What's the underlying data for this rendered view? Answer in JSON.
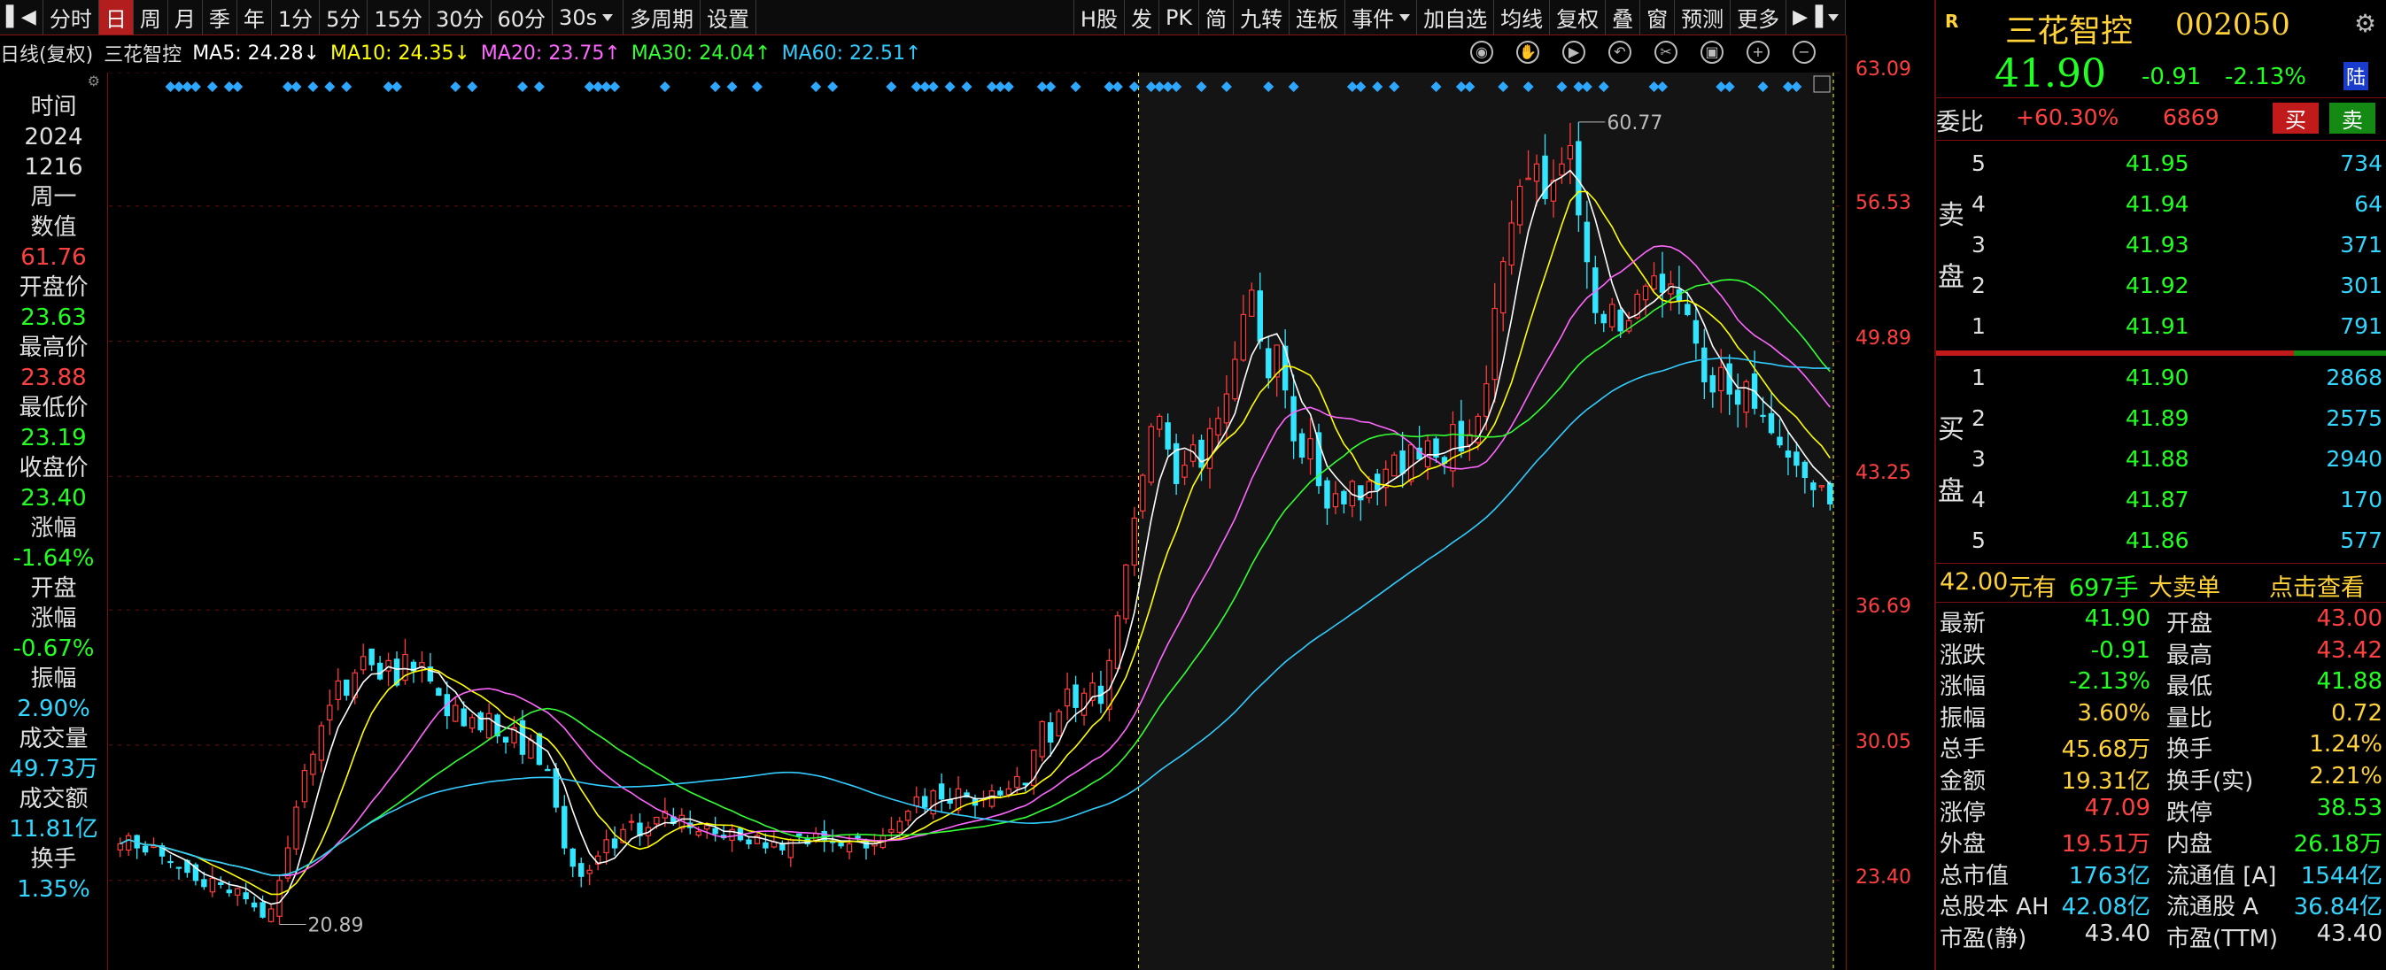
{
  "toolbar": {
    "left": [
      {
        "label": "分时",
        "active": false
      },
      {
        "label": "日",
        "active": true
      },
      {
        "label": "周",
        "active": false
      },
      {
        "label": "月",
        "active": false
      },
      {
        "label": "季",
        "active": false
      },
      {
        "label": "年",
        "active": false
      },
      {
        "label": "1分",
        "active": false
      },
      {
        "label": "5分",
        "active": false
      },
      {
        "label": "15分",
        "active": false
      },
      {
        "label": "30分",
        "active": false
      },
      {
        "label": "60分",
        "active": false
      }
    ],
    "period_select": "30s",
    "multi": "多周期",
    "settings": "设置",
    "right": [
      "H股",
      "发",
      "PK",
      "简",
      "九转",
      "连板",
      "事件"
    ],
    "right2": [
      "加自选",
      "均线",
      "复权",
      "叠",
      "窗",
      "预测",
      "更多"
    ]
  },
  "ma": {
    "mode": "日线(复权)",
    "stock": "三花智控",
    "ma5": "MA5: 24.28↓",
    "ma10": "MA10: 24.35↓",
    "ma20": "MA20: 23.75↑",
    "ma30": "MA30: 24.04↑",
    "ma60": "MA60: 22.51↑",
    "colors": {
      "ma5": "#ffffff",
      "ma10": "#ffff00",
      "ma20": "#ff66ff",
      "ma30": "#33ff33",
      "ma60": "#33ccff"
    }
  },
  "left_info": [
    {
      "label": "时间",
      "values": [
        {
          "v": "2024",
          "c": "white"
        },
        {
          "v": "1216",
          "c": "white"
        },
        {
          "v": "周一",
          "c": "white"
        }
      ]
    },
    {
      "label": "数值",
      "values": [
        {
          "v": "61.76",
          "c": "red"
        }
      ]
    },
    {
      "label": "开盘价",
      "values": [
        {
          "v": "23.63",
          "c": "green"
        }
      ]
    },
    {
      "label": "最高价",
      "values": [
        {
          "v": "23.88",
          "c": "red"
        }
      ]
    },
    {
      "label": "最低价",
      "values": [
        {
          "v": "23.19",
          "c": "green"
        }
      ]
    },
    {
      "label": "收盘价",
      "values": [
        {
          "v": "23.40",
          "c": "green"
        }
      ]
    },
    {
      "label": "涨幅",
      "values": [
        {
          "v": "-1.64%",
          "c": "green"
        }
      ]
    },
    {
      "label": "开盘",
      "values": []
    },
    {
      "label": "涨幅",
      "values": [
        {
          "v": "-0.67%",
          "c": "green"
        }
      ]
    },
    {
      "label": "振幅",
      "values": [
        {
          "v": "2.90%",
          "c": "cyan"
        }
      ]
    },
    {
      "label": "成交量",
      "values": [
        {
          "v": "49.73万",
          "c": "cyan"
        }
      ]
    },
    {
      "label": "成交额",
      "values": [
        {
          "v": "11.81亿",
          "c": "cyan"
        }
      ]
    },
    {
      "label": "换手",
      "values": [
        {
          "v": "1.35%",
          "c": "cyan"
        }
      ]
    }
  ],
  "chart_data": {
    "type": "candlestick",
    "y_ticks": [
      "63.09",
      "56.53",
      "49.89",
      "43.25",
      "36.69",
      "30.05",
      "23.40"
    ],
    "ylim": [
      19.0,
      63.09
    ],
    "annotations": {
      "max_label": "60.77",
      "min_label": "20.89"
    },
    "closes": [
      25.2,
      25.6,
      25.0,
      24.8,
      25.1,
      24.6,
      24.3,
      24.0,
      23.8,
      23.4,
      23.1,
      23.5,
      23.2,
      22.8,
      23.0,
      22.5,
      22.1,
      21.6,
      22.0,
      23.4,
      25.0,
      27.0,
      28.8,
      29.6,
      31.0,
      32.0,
      33.2,
      32.5,
      33.6,
      34.4,
      34.0,
      33.3,
      34.2,
      33.0,
      34.5,
      33.7,
      34.1,
      33.2,
      32.5,
      31.5,
      32.0,
      31.0,
      31.4,
      30.8,
      31.6,
      30.5,
      30.2,
      30.9,
      29.6,
      30.3,
      29.1,
      28.8,
      27.0,
      25.0,
      24.1,
      23.6,
      23.9,
      24.6,
      25.4,
      25.0,
      25.9,
      26.3,
      25.6,
      26.0,
      26.5,
      26.8,
      26.2,
      26.6,
      26.0,
      25.8,
      26.1,
      25.7,
      25.5,
      25.9,
      25.4,
      25.2,
      25.6,
      25.0,
      25.3,
      24.9,
      25.4,
      25.6,
      25.2,
      25.7,
      25.4,
      25.3,
      25.1,
      25.2,
      25.5,
      25.0,
      25.2,
      25.6,
      25.9,
      26.3,
      26.8,
      27.5,
      27.0,
      27.8,
      27.4,
      27.2,
      27.9,
      27.5,
      27.1,
      27.4,
      27.8,
      27.6,
      27.9,
      28.5,
      28.1,
      29.8,
      31.2,
      30.2,
      31.7,
      32.8,
      31.9,
      32.6,
      33.1,
      32.1,
      34.2,
      36.4,
      38.9,
      41.2,
      43.3,
      45.7,
      46.2,
      44.6,
      42.9,
      43.8,
      44.8,
      43.7,
      45.6,
      46.1,
      47.3,
      49.0,
      51.2,
      52.4,
      49.9,
      48.1,
      49.7,
      47.5,
      45.0,
      44.2,
      45.1,
      42.8,
      41.7,
      42.4,
      41.9,
      43.0,
      42.1,
      43.0,
      42.6,
      43.6,
      44.3,
      43.4,
      44.8,
      44.1,
      45.0,
      44.2,
      43.9,
      45.8,
      44.5,
      45.3,
      46.2,
      47.8,
      51.5,
      53.8,
      55.7,
      57.5,
      57.9,
      58.6,
      56.9,
      57.8,
      58.6,
      59.5,
      56.1,
      53.8,
      51.3,
      50.8,
      51.7,
      50.4,
      50.9,
      52.2,
      52.6,
      53.1,
      52.3,
      52.7,
      51.9,
      51.2,
      49.8,
      47.9,
      47.4,
      48.6,
      47.3,
      46.8,
      47.9,
      46.6,
      46.2,
      45.4,
      44.8,
      44.2,
      43.8,
      43.2,
      42.6,
      42.8,
      41.9
    ],
    "ma_series": [
      "MA5",
      "MA10",
      "MA20",
      "MA30",
      "MA60"
    ]
  },
  "quote": {
    "name": "三花智控",
    "code": "002050",
    "price": "41.90",
    "change": "-0.91",
    "pct": "-2.13%",
    "badge": "陆",
    "r_badge": "R",
    "weibi_label": "委比",
    "weibi": "+60.30%",
    "weicha": "6869",
    "buy_btn": "买",
    "sell_btn": "卖",
    "sell_label": [
      "卖",
      "盘"
    ],
    "buy_label": [
      "买",
      "盘"
    ],
    "asks": [
      {
        "lvl": "5",
        "price": "41.95",
        "vol": "734"
      },
      {
        "lvl": "4",
        "price": "41.94",
        "vol": "64"
      },
      {
        "lvl": "3",
        "price": "41.93",
        "vol": "371"
      },
      {
        "lvl": "2",
        "price": "41.92",
        "vol": "301"
      },
      {
        "lvl": "1",
        "price": "41.91",
        "vol": "791"
      }
    ],
    "bids": [
      {
        "lvl": "1",
        "price": "41.90",
        "vol": "2868"
      },
      {
        "lvl": "2",
        "price": "41.89",
        "vol": "2575"
      },
      {
        "lvl": "3",
        "price": "41.88",
        "vol": "2940"
      },
      {
        "lvl": "4",
        "price": "41.87",
        "vol": "170"
      },
      {
        "lvl": "5",
        "price": "41.86",
        "vol": "577"
      }
    ],
    "bigorder_price": "42.00",
    "bigorder_text": "元有",
    "bigorder_vol": "697手",
    "bigorder_label": "大卖单",
    "bigorder_link": "点击查看",
    "stats": [
      [
        "最新",
        "41.90",
        "g",
        "开盘",
        "43.00",
        "r"
      ],
      [
        "涨跌",
        "-0.91",
        "g",
        "最高",
        "43.42",
        "r"
      ],
      [
        "涨幅",
        "-2.13%",
        "g",
        "最低",
        "41.88",
        "g"
      ],
      [
        "振幅",
        "3.60%",
        "y",
        "量比",
        "0.72",
        "y"
      ],
      [
        "总手",
        "45.68万",
        "y",
        "换手",
        "1.24%",
        "y"
      ],
      [
        "金额",
        "19.31亿",
        "y",
        "换手(实)",
        "2.21%",
        "y"
      ],
      [
        "涨停",
        "47.09",
        "r",
        "跌停",
        "38.53",
        "g"
      ],
      [
        "外盘",
        "19.51万",
        "r",
        "内盘",
        "26.18万",
        "g"
      ],
      [
        "总市值",
        "1763亿",
        "c",
        "流通值 [A]",
        "1544亿",
        "c"
      ],
      [
        "总股本 AH",
        "42.08亿",
        "c",
        "流通股 A",
        "36.84亿",
        "c"
      ],
      [
        "市盈(静)",
        "43.40",
        "w",
        "市盈(TTM)",
        "43.40",
        "w"
      ]
    ]
  }
}
